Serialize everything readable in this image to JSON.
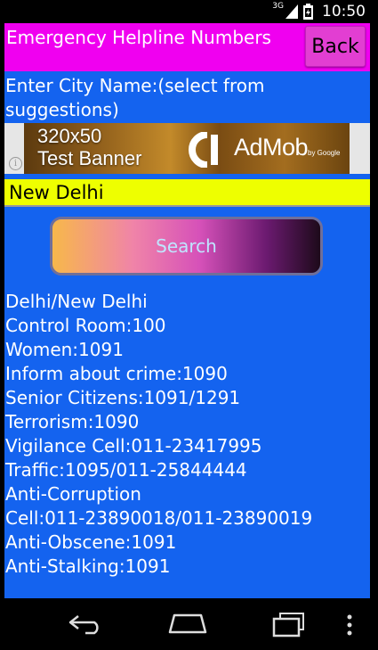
{
  "status_bar": {
    "network": "3G",
    "time": "10:50"
  },
  "header": {
    "title": "Emergency Helpline Numbers",
    "back_label": "Back"
  },
  "city_prompt": "Enter City Name:(select from suggestions)",
  "ad": {
    "size_label": "320x50",
    "test_label": "Test Banner",
    "brand": "AdMob",
    "sub_brand": "by Google",
    "info": "i"
  },
  "city_input": {
    "value": "New Delhi"
  },
  "search_label": "Search",
  "results": [
    "Delhi/New Delhi",
    "Control Room:100",
    "Women:1091",
    "Inform about crime:1090",
    "Senior Citizens:1091/1291",
    "Terrorism:1090",
    "Vigilance Cell:011-23417995",
    "Traffic:1095/011-25844444",
    "Anti-Corruption",
    "Cell:011-23890018/011-23890019",
    "Anti-Obscene:1091",
    "Anti-Stalking:1091"
  ],
  "colors": {
    "background": "#1463ef",
    "header": "#f000f0",
    "input_bg": "#eeff00"
  },
  "icons": {
    "signal": "signal-icon",
    "battery": "battery-icon",
    "nav_back": "nav-back-icon",
    "nav_home": "nav-home-icon",
    "nav_recents": "nav-recents-icon",
    "nav_menu": "overflow-menu-icon"
  }
}
